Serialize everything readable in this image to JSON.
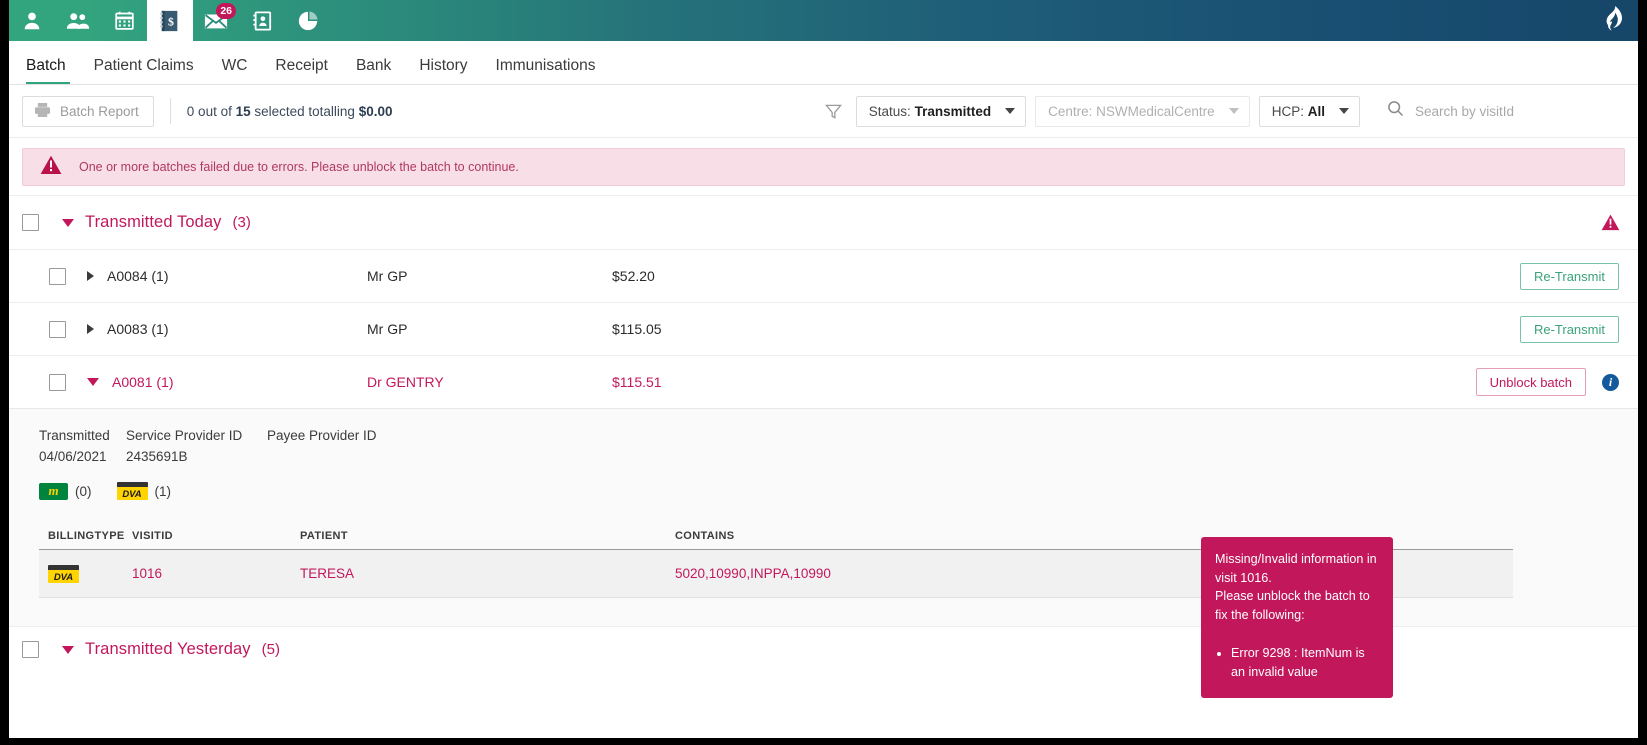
{
  "appbar": {
    "icons": [
      {
        "name": "person-icon",
        "label": "Patient"
      },
      {
        "name": "people-icon",
        "label": "Patients"
      },
      {
        "name": "calendar-icon",
        "label": "Appointments"
      },
      {
        "name": "billing-book-icon",
        "label": "Billing"
      },
      {
        "name": "mail-icon",
        "label": "Messages",
        "badge": "26"
      },
      {
        "name": "contact-card-icon",
        "label": "Contacts"
      },
      {
        "name": "pie-chart-icon",
        "label": "Reports"
      }
    ],
    "brand": "flame-logo"
  },
  "tabs": [
    {
      "label": "Batch",
      "active": true
    },
    {
      "label": "Patient Claims",
      "active": false
    },
    {
      "label": "WC",
      "active": false
    },
    {
      "label": "Receipt",
      "active": false
    },
    {
      "label": "Bank",
      "active": false
    },
    {
      "label": "History",
      "active": false
    },
    {
      "label": "Immunisations",
      "active": false
    }
  ],
  "filterbar": {
    "batch_report_label": "Batch Report",
    "summary_prefix": "0 out of ",
    "summary_count": "15",
    "summary_mid": " selected totalling ",
    "summary_total": "$0.00",
    "status_label": "Status:",
    "status_value": "Transmitted",
    "centre_label": "Centre:",
    "centre_value": "NSWMedicalCentre",
    "hcp_label": "HCP:",
    "hcp_value": "All",
    "search_placeholder": "Search by visitId",
    "search_value": ""
  },
  "alert": {
    "message": "One or more batches failed due to errors. Please unblock the batch to continue."
  },
  "group": {
    "title": "Transmitted Today",
    "count": "(3)"
  },
  "batches": [
    {
      "id": "A0084 (1)",
      "provider": "Mr GP",
      "amount": "$52.20",
      "action": "Re-Transmit",
      "expanded": false,
      "error": false
    },
    {
      "id": "A0083 (1)",
      "provider": "Mr GP",
      "amount": "$115.05",
      "action": "Re-Transmit",
      "expanded": false,
      "error": false
    },
    {
      "id": "A0081 (1)",
      "provider": "Dr GENTRY",
      "amount": "$115.51",
      "action": "Unblock batch",
      "expanded": true,
      "error": true
    }
  ],
  "detail": {
    "transmitted_label": "Transmitted",
    "transmitted_value": "04/06/2021",
    "service_provider_label": "Service Provider ID",
    "service_provider_value": "2435691B",
    "payee_provider_label": "Payee Provider ID",
    "payee_provider_value": "",
    "medicare_count": "(0)",
    "medicare_badge": "m",
    "dva_count": "(1)",
    "dva_badge": "DVA",
    "columns": [
      "BILLINGTYPE",
      "VISITID",
      "PATIENT",
      "CONTAINS"
    ],
    "rows": [
      {
        "billingtype": "DVA",
        "visitid": "1016",
        "patient": "TERESA",
        "contains": "5020,10990,INPPA,10990"
      }
    ]
  },
  "tooltip": {
    "line1": "Missing/Invalid information in visit 1016.",
    "line2": "Please unblock the batch to fix the following:",
    "items": [
      "Error 9298 : ItemNum is an invalid value"
    ]
  },
  "bottom_group": {
    "title": "Transmitted Yesterday",
    "count": "(5)"
  },
  "colors": {
    "brand_green": "#33a57e",
    "brand_blue": "#164668",
    "accent_pink": "#c2185b",
    "alert_bg": "#f8dfe7",
    "info_blue": "#14599b"
  }
}
